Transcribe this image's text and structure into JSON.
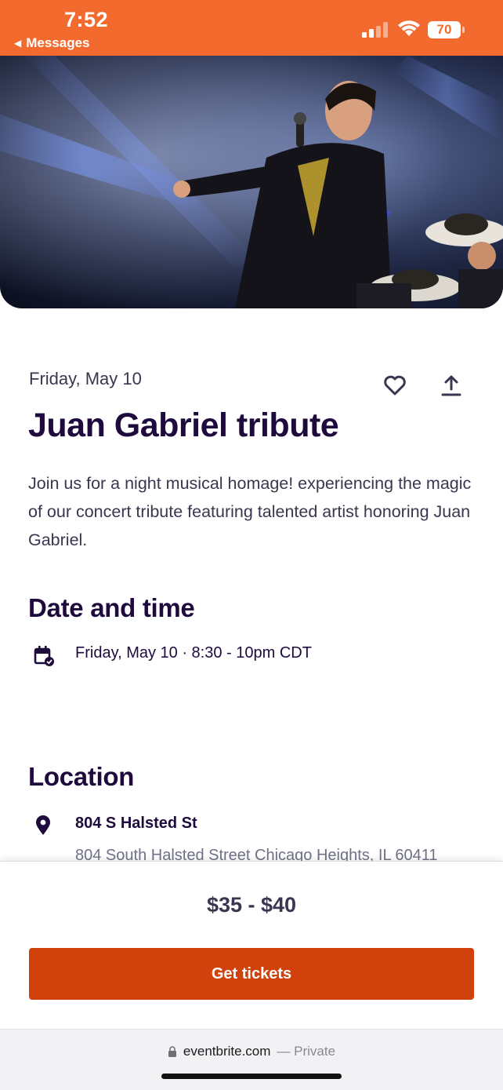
{
  "status_bar": {
    "time": "7:52",
    "back_label": "Messages",
    "battery": "70",
    "background_color": "#f36a2e"
  },
  "hero": {
    "image_description_icon": "concert-photo"
  },
  "event": {
    "date_short": "Friday, May 10",
    "title": "Juan Gabriel tribute",
    "summary": "Join us for a night musical homage! experiencing the magic of our concert tribute featuring talented artist honoring Juan Gabriel."
  },
  "actions": {
    "like_icon": "heart-icon",
    "share_icon": "share-icon"
  },
  "date_time_section": {
    "heading": "Date and time",
    "icon": "calendar-check-icon",
    "value": "Friday, May 10 · 8:30 - 10pm CDT"
  },
  "location_section": {
    "heading": "Location",
    "icon": "map-pin-icon",
    "venue_name": "804 S Halsted St",
    "venue_address": "804 South Halsted Street Chicago Heights, IL 60411"
  },
  "tickets": {
    "price": "$35 - $40",
    "button_label": "Get tickets",
    "button_color": "#d1410c"
  },
  "browser": {
    "domain": "eventbrite.com",
    "mode": "— Private"
  }
}
